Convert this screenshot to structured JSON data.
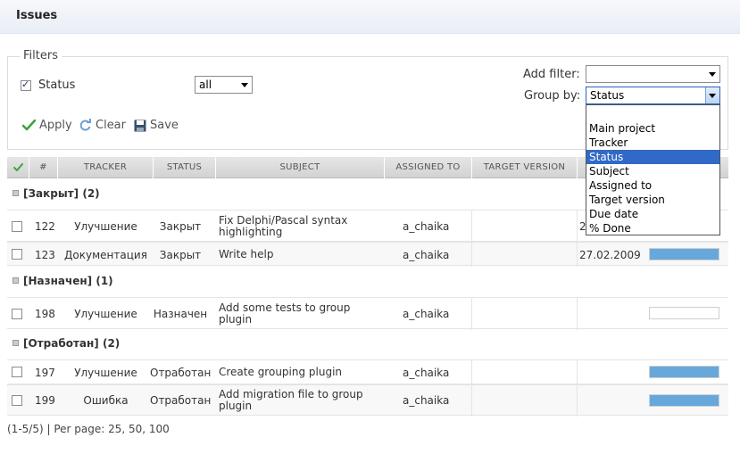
{
  "page": {
    "title": "Issues"
  },
  "filters": {
    "legend": "Filters",
    "status_label": "Status",
    "status_checked": true,
    "status_operator": "all",
    "add_filter_label": "Add filter:",
    "add_filter_value": "",
    "group_by_label": "Group by:",
    "group_by_value": "Status",
    "group_by_options": [
      "",
      "Main project",
      "Tracker",
      "Status",
      "Subject",
      "Assigned to",
      "Target version",
      "Due date",
      "% Done"
    ],
    "actions": {
      "apply": "Apply",
      "clear": "Clear",
      "save": "Save"
    }
  },
  "table": {
    "headers": {
      "check": "",
      "id": "#",
      "tracker": "TRACKER",
      "status": "STATUS",
      "subject": "SUBJECT",
      "assigned": "ASSIGNED TO",
      "target": "TARGET VERSION",
      "due": ""
    },
    "groups": [
      {
        "label": "[Закрыт]",
        "count": "(2)",
        "rows": [
          {
            "id": "122",
            "tracker": "Улучшение",
            "status": "Закрыт",
            "subject": "Fix Delphi/Pascal syntax highlighting",
            "assigned": "a_chaika",
            "due": "2",
            "done": 1.0
          },
          {
            "id": "123",
            "tracker": "Документация",
            "status": "Закрыт",
            "subject": "Write help",
            "assigned": "a_chaika",
            "due": "27.02.2009",
            "done": 1.0
          }
        ]
      },
      {
        "label": "[Назначен]",
        "count": "(1)",
        "rows": [
          {
            "id": "198",
            "tracker": "Улучшение",
            "status": "Назначен",
            "subject": "Add some tests to group plugin",
            "assigned": "a_chaika",
            "due": "",
            "done": 0.0
          }
        ]
      },
      {
        "label": "[Отработан]",
        "count": "(2)",
        "rows": [
          {
            "id": "197",
            "tracker": "Улучшение",
            "status": "Отработан",
            "subject": "Create grouping plugin",
            "assigned": "a_chaika",
            "due": "",
            "done": 1.0
          },
          {
            "id": "199",
            "tracker": "Ошибка",
            "status": "Отработан",
            "subject": "Add migration file to group plugin",
            "assigned": "a_chaika",
            "due": "",
            "done": 1.0
          }
        ]
      }
    ]
  },
  "pager": {
    "summary": "(1-5/5) | Per page:",
    "options": "25, 50, 100"
  },
  "colors": {
    "accent": "#3169c6",
    "progress": "#67a8dc"
  }
}
